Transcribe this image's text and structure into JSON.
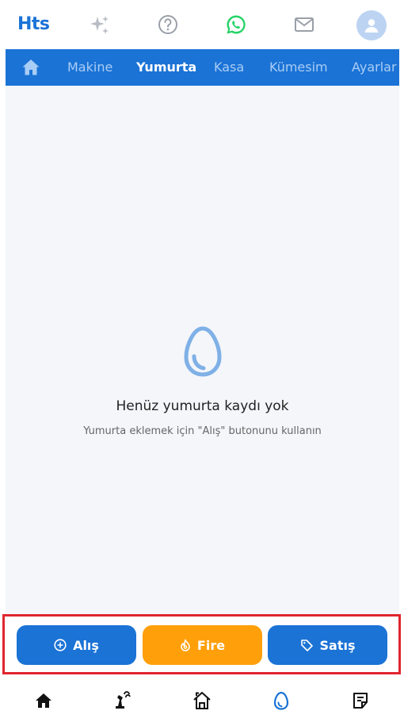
{
  "app": {
    "logo": "Hts"
  },
  "topbar": {
    "icons": [
      "sparkle-icon",
      "help-icon",
      "whatsapp-icon",
      "mail-icon",
      "account-icon"
    ]
  },
  "nav": {
    "tabs": [
      {
        "label": "Makine"
      },
      {
        "label": "Yumurta"
      },
      {
        "label": "Kasa"
      },
      {
        "label": "Kümesim"
      },
      {
        "label": "Ayarlar"
      }
    ],
    "active_tab": "Yumurta"
  },
  "empty_state": {
    "icon": "egg-icon",
    "title": "Henüz yumurta kaydı yok",
    "subtitle": "Yumurta eklemek için \"Alış\" butonunu kullanın"
  },
  "actions": {
    "buy": "Alış",
    "waste": "Fire",
    "sell": "Satış"
  },
  "bottom_nav": {
    "items": [
      "home-icon",
      "machine-icon",
      "coop-icon",
      "egg-icon",
      "notes-icon"
    ],
    "active": "egg-icon"
  },
  "colors": {
    "primary": "#1b73d6",
    "accent_orange": "#ff9f0a",
    "highlight_red": "#e0252f",
    "whatsapp_green": "#25d366"
  }
}
